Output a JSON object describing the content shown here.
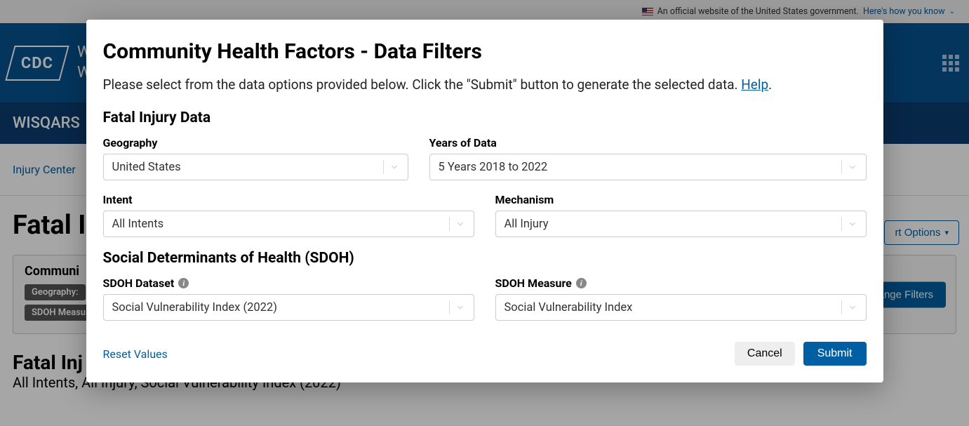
{
  "gov_banner": {
    "text": "An official website of the United States government.",
    "link": "Here's how you know"
  },
  "header": {
    "logo": "CDC",
    "title_line1": "W",
    "title_line2": "W"
  },
  "subheader": {
    "title": "WISQARS"
  },
  "breadcrumb": {
    "item": "Injury Center"
  },
  "page": {
    "h1": "Fatal I",
    "report_options": "rt Options",
    "filter_box_title": "Communi",
    "chip_geo": "Geography:",
    "chip_measure": "SDOH Measu",
    "change_filters": "ange Filters",
    "section_h2": "Fatal Inj",
    "section_sub": "All Intents, All Injury, Social Vulnerability Index (2022)"
  },
  "modal": {
    "title": "Community Health Factors - Data Filters",
    "description_pre": "Please select from the data options provided below. Click the \"Submit\" button to generate the selected data.  ",
    "help": "Help",
    "description_post": ".",
    "section1": "Fatal Injury Data",
    "fields": {
      "geography": {
        "label": "Geography",
        "value": "United States"
      },
      "years": {
        "label": "Years of Data",
        "value": "5 Years 2018 to 2022"
      },
      "intent": {
        "label": "Intent",
        "value": "All Intents"
      },
      "mechanism": {
        "label": "Mechanism",
        "value": "All Injury"
      },
      "sdoh_dataset": {
        "label": "SDOH Dataset",
        "value": "Social Vulnerability Index (2022)"
      },
      "sdoh_measure": {
        "label": "SDOH Measure",
        "value": "Social Vulnerability Index"
      }
    },
    "section2": "Social Determinants of Health (SDOH)",
    "reset": "Reset Values",
    "cancel": "Cancel",
    "submit": "Submit"
  }
}
